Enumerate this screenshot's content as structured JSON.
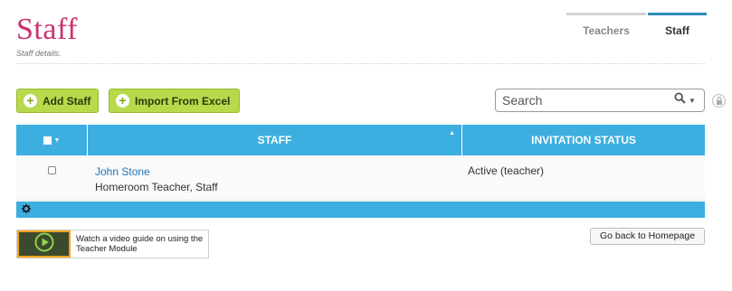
{
  "header": {
    "title": "Staff",
    "subtitle": "Staff details."
  },
  "tabs": [
    {
      "label": "Teachers",
      "active": false
    },
    {
      "label": "Staff",
      "active": true
    }
  ],
  "toolbar": {
    "add_label": "Add Staff",
    "import_label": "Import From Excel"
  },
  "search": {
    "placeholder": "Search"
  },
  "grid": {
    "columns": [
      "STAFF",
      "INVITATION STATUS"
    ],
    "rows": [
      {
        "name": "John Stone",
        "role": "Homeroom Teacher, Staff",
        "status": "Active (teacher)"
      }
    ]
  },
  "footer": {
    "video_text": "Watch a video guide on using the Teacher Module",
    "home_label": "Go back to Homepage"
  },
  "colors": {
    "brand": "#c8336f",
    "grid_header": "#3daee0",
    "button_green": "#b8d94b"
  },
  "icons": [
    "plus-circle-icon",
    "search-icon",
    "lock-icon",
    "checkbox-icon",
    "sort-arrow-icon",
    "gear-icon",
    "play-icon"
  ]
}
